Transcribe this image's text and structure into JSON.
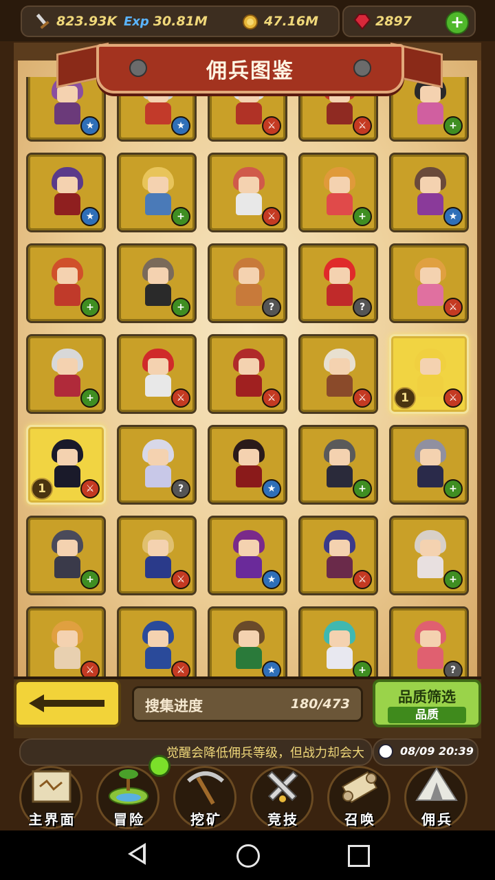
{
  "resources": {
    "attack": "823.93K",
    "exp_label": "Exp",
    "exp": "30.81M",
    "gold": "47.16M",
    "gems": "2897"
  },
  "title": "佣兵图鉴",
  "cards": [
    {
      "hair": "#8a4fa0",
      "body": "#6b3a7a",
      "badge": "star",
      "active": false
    },
    {
      "hair": "#cfcfcf",
      "body": "#c23a2a",
      "badge": "star",
      "active": false
    },
    {
      "hair": "#e0e0e0",
      "body": "#b03226",
      "badge": "atk",
      "active": false
    },
    {
      "hair": "#c23a2a",
      "body": "#8f2a22",
      "badge": "atk",
      "active": false
    },
    {
      "hair": "#2a2a2a",
      "body": "#d05fa0",
      "badge": "plus",
      "active": false
    },
    {
      "hair": "#5a3a8a",
      "body": "#8f1f1f",
      "badge": "star",
      "active": false
    },
    {
      "hair": "#e8c45a",
      "body": "#4a7ab8",
      "badge": "plus",
      "active": false
    },
    {
      "hair": "#d05a4a",
      "body": "#e8e8e8",
      "badge": "atk",
      "active": false
    },
    {
      "hair": "#e09a3a",
      "body": "#e04a4a",
      "badge": "plus",
      "active": false
    },
    {
      "hair": "#6a4a3a",
      "body": "#8a3a9a",
      "badge": "star",
      "active": false
    },
    {
      "hair": "#d0502a",
      "body": "#c03a2a",
      "badge": "plus",
      "active": false
    },
    {
      "hair": "#7a6a5a",
      "body": "#2a2a2a",
      "badge": "plus",
      "active": false
    },
    {
      "hair": "#c87a3a",
      "body": "#c87a3a",
      "badge": "q",
      "active": false
    },
    {
      "hair": "#e02a2a",
      "body": "#c02a2a",
      "badge": "q",
      "active": false
    },
    {
      "hair": "#e0a040",
      "body": "#e070a0",
      "badge": "atk",
      "active": false
    },
    {
      "hair": "#d8d8d8",
      "body": "#b02a3a",
      "badge": "plus",
      "active": false
    },
    {
      "hair": "#d02a2a",
      "body": "#e8e8e8",
      "badge": "atk",
      "active": false
    },
    {
      "hair": "#b02a2a",
      "body": "#a02020",
      "badge": "atk",
      "active": false
    },
    {
      "hair": "#e8e0d0",
      "body": "#8a4a2a",
      "badge": "atk",
      "active": false
    },
    {
      "hair": "#f0d040",
      "body": "#f0d040",
      "badge": "atk",
      "active": true,
      "level": "1"
    },
    {
      "hair": "#1a1a2a",
      "body": "#1a1a2a",
      "badge": "atk",
      "active": true,
      "level": "1"
    },
    {
      "hair": "#d8d8e8",
      "body": "#c8c8e8",
      "badge": "q",
      "active": false
    },
    {
      "hair": "#2a1a1a",
      "body": "#8a1a1a",
      "badge": "star",
      "active": false
    },
    {
      "hair": "#5a5a5a",
      "body": "#2a2a3a",
      "badge": "plus",
      "active": false
    },
    {
      "hair": "#9090a0",
      "body": "#2a2a4a",
      "badge": "plus",
      "active": false
    },
    {
      "hair": "#4a4a5a",
      "body": "#3a3a4a",
      "badge": "plus",
      "active": false
    },
    {
      "hair": "#e0c070",
      "body": "#2a3a8a",
      "badge": "atk",
      "active": false
    },
    {
      "hair": "#7a2a8a",
      "body": "#6a2a9a",
      "badge": "star",
      "active": false
    },
    {
      "hair": "#3a3a8a",
      "body": "#6a2a4a",
      "badge": "atk",
      "active": false
    },
    {
      "hair": "#d8d0c8",
      "body": "#e8e0e0",
      "badge": "plus",
      "active": false
    },
    {
      "hair": "#e0a040",
      "body": "#e8d0b0",
      "badge": "atk",
      "active": false
    },
    {
      "hair": "#2a4a9a",
      "body": "#2a4a9a",
      "badge": "atk",
      "active": false
    },
    {
      "hair": "#6a4a2a",
      "body": "#2a7a3a",
      "badge": "star",
      "active": false
    },
    {
      "hair": "#40b8b0",
      "body": "#e8e8f0",
      "badge": "plus",
      "active": false
    },
    {
      "hair": "#e06070",
      "body": "#e06070",
      "badge": "q",
      "active": false
    }
  ],
  "badge_glyphs": {
    "star": "★",
    "plus": "+",
    "atk": "⚔",
    "q": "?"
  },
  "progress": {
    "label": "搜集进度",
    "value": "180/473"
  },
  "filter": {
    "title": "品质筛选",
    "subtitle": "品质"
  },
  "tip": "觉醒会降低佣兵等级，但战力却会大",
  "datetime": "08/09 20:39",
  "nav": [
    {
      "label": "主界面",
      "icon": "map-icon"
    },
    {
      "label": "冒险",
      "icon": "island-icon"
    },
    {
      "label": "挖矿",
      "icon": "pickaxe-icon"
    },
    {
      "label": "竞技",
      "icon": "swords-icon"
    },
    {
      "label": "召唤",
      "icon": "scroll-icon"
    },
    {
      "label": "佣兵",
      "icon": "tent-icon"
    }
  ]
}
